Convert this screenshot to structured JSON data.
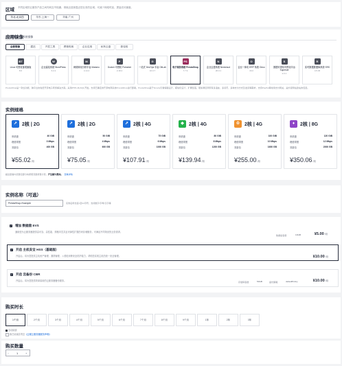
{
  "region": {
    "title": "区域",
    "note": "不同区域的云服务产品之间内网互不相通，请就近选择靠近您业务的区域，可减少网络时延、提高访问速度。",
    "selected": "华北-北京四",
    "options": [
      "华东-上海一",
      "华南-广州"
    ]
  },
  "image": {
    "title": "应用镜像",
    "tabs": [
      "应用镜像",
      "系统镜像"
    ],
    "categories": [
      "全部镜像",
      "建站",
      "开发工具",
      "跨境电商",
      "企业应用",
      "私有云盘",
      "新径段"
    ],
    "items": [
      {
        "name": "Linux 可视化宝塔面板",
        "version": "8.0",
        "icon": "bt-icon",
        "short": "BT"
      },
      {
        "name": "企业建站系统 WordPress",
        "version": "6.2.2",
        "icon": "wordpress-icon",
        "short": "W"
      },
      {
        "name": "网络转化分析平台 Matomo",
        "version": "4.14.2",
        "icon": "matomo-icon",
        "short": "M"
      },
      {
        "name": "Docker 可视化 Portainer",
        "version": "2.18.4",
        "icon": "portainer-icon",
        "short": "P"
      },
      {
        "name": "一站式 DevOps 平台 GitLab",
        "version": "16.0.7",
        "icon": "gitlab-icon",
        "short": "G"
      },
      {
        "name": "电子商务系统 PrestaShop",
        "version": "7.7.9",
        "icon": "prestashop-icon",
        "short": "PS"
      },
      {
        "name": "企业云盘系统 Nextcloud",
        "version": "26.0.1",
        "icon": "nextcloud-icon",
        "short": "N"
      },
      {
        "name": "企业一体化 ERP 系统 Odoo",
        "version": "16.0",
        "icon": "odoo-icon",
        "short": "O"
      },
      {
        "name": "数据可视化可视化平台 Superset",
        "version": "2.0.1",
        "icon": "superset-icon",
        "short": "S"
      },
      {
        "name": "实时数据数据库系统 SRS",
        "version": "4.5.45",
        "icon": "srs-icon",
        "short": "R"
      }
    ],
    "description": "PrestaShop是一款全功能、跨平台的免费开源电子商务解决方案。采用PHP+MySQL开发。支持已确定的开源电商系统PrestaShop进行部署。PrestaShop基于Smarty引擎编程设计，模块化设计，扩展性强。能够满足商家有多语言、多货币、多种支付方式及发货等需求，支持PayPal等常用支付网关，是外贸网站建站的佳选。"
  },
  "specs": {
    "title": "实例规格",
    "labels": {
      "system_disk": "系统盘",
      "bandwidth": "峰值带宽",
      "traffic": "流量包"
    },
    "unit": "/月",
    "items": [
      {
        "name": "2核 | 2G",
        "system_disk": "40 GiB",
        "bandwidth": "3 Mbps",
        "traffic": "400 GB",
        "price": "¥55.02",
        "color": "#1e6fdc"
      },
      {
        "name": "2核 | 2G",
        "system_disk": "50 GiB",
        "bandwidth": "4 Mbps",
        "traffic": "600 GB",
        "price": "¥75.05",
        "color": "#1e6fdc"
      },
      {
        "name": "2核 | 4G",
        "system_disk": "75 GiB",
        "bandwidth": "6 Mbps",
        "traffic": "1000 GB",
        "price": "¥107.91",
        "color": "#1e6fdc"
      },
      {
        "name": "2核 | 4G",
        "system_disk": "80 GiB",
        "bandwidth": "8 Mbps",
        "traffic": "1200 GB",
        "price": "¥139.94",
        "color": "#24b24b"
      },
      {
        "name": "2核 | 4G",
        "system_disk": "100 GiB",
        "bandwidth": "10 Mbps",
        "traffic": "1600 GB",
        "price": "¥255.00",
        "color": "#f0922f"
      },
      {
        "name": "2核 | 8G",
        "system_disk": "120 GiB",
        "bandwidth": "12 Mbps",
        "traffic": "2000 GB",
        "price": "¥350.06",
        "color": "#8e44c7"
      }
    ],
    "note": "超出套餐内流量包部分将按照流量按量计费，",
    "note_link": "查看详情",
    "note_strong": "产生额外费用。"
  },
  "instance_name": {
    "title": "实例名称（可选）",
    "value": "PrestaShop-Example",
    "hint": "实例名称长度1至64字符，支持数字/字母/汉字等"
  },
  "addons": [
    {
      "title": "增加 数据盘 EVS",
      "desc": "通用型为云服务器提供高可靠、高性能、规格丰富并且可弹性扩展的块存储服务，可满足不同场景的业务需求。",
      "field_label": "数据盘容量",
      "field_value": "10GB",
      "price": "¥5.00",
      "unit": "/月",
      "checked": true,
      "selected": false
    },
    {
      "title": "开启 主机安全 HSS（基础版）",
      "desc": "开启后，将为您提供主机资产管理、漏洞管理、入侵检测等安全防护能力，帮助您实现主机的统一安全管理。",
      "price": "¥10.00",
      "unit": "/月",
      "checked": true,
      "selected": true
    },
    {
      "title": "开启 云备份 CBR",
      "desc": "开启后，将为您提供简单易用的云服务器备份服务。",
      "field_label": "存储库容量",
      "field_value": "50GB",
      "field_label2": "备份策略",
      "field_value2": "defaultPolicy",
      "price": "¥10.00",
      "unit": "/月",
      "checked": true,
      "selected": false
    }
  ],
  "duration": {
    "title": "购买时长",
    "options": [
      "1个月",
      "2个月",
      "3个月",
      "4个月",
      "5个月",
      "6个月",
      "7个月",
      "8个月",
      "9个月",
      "1年",
      "2年",
      "3年"
    ],
    "selected": "1个月",
    "auto_renew": "自动续费",
    "agreement_prefix": "我已阅读并同意",
    "agreement_link": "《云耀云服务器服务声明》"
  },
  "quantity": {
    "title": "购买数量",
    "value": "1",
    "minus": "−",
    "plus": "+"
  }
}
